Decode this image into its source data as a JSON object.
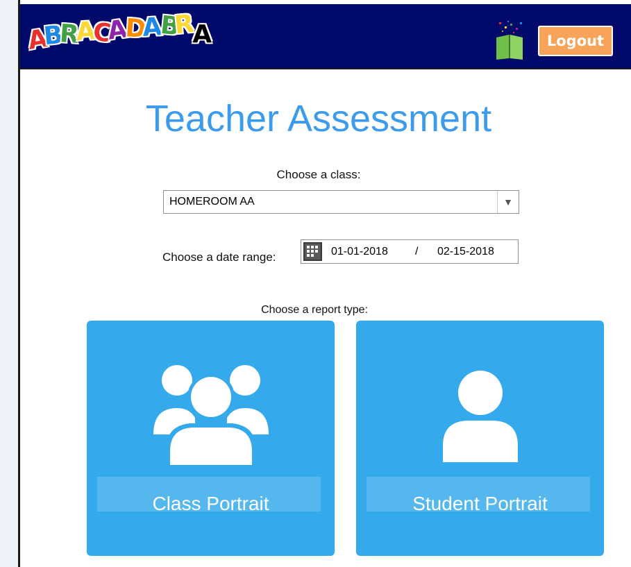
{
  "header": {
    "logo_text": "ABRACADABRA",
    "logo_letters": [
      "A",
      "B",
      "R",
      "A",
      "C",
      "A",
      "D",
      "A",
      "B",
      "R",
      "A"
    ],
    "logout_label": "Logout",
    "background_color": "#010a6b",
    "logout_color": "#f7a35a"
  },
  "main": {
    "title": "Teacher Assessment",
    "class_prompt": "Choose a class:",
    "class_selected": "HOMEROOM AA",
    "date_prompt": "Choose a date range:",
    "date_start": "01-01-2018",
    "date_separator": "/",
    "date_end": "02-15-2018",
    "report_prompt": "Choose a report type:",
    "report_types": [
      {
        "label": "Class Portrait",
        "icon": "group-icon"
      },
      {
        "label": "Student Portrait",
        "icon": "person-icon"
      }
    ],
    "accent_color": "#3d9bec",
    "card_color": "#34a9eb"
  }
}
